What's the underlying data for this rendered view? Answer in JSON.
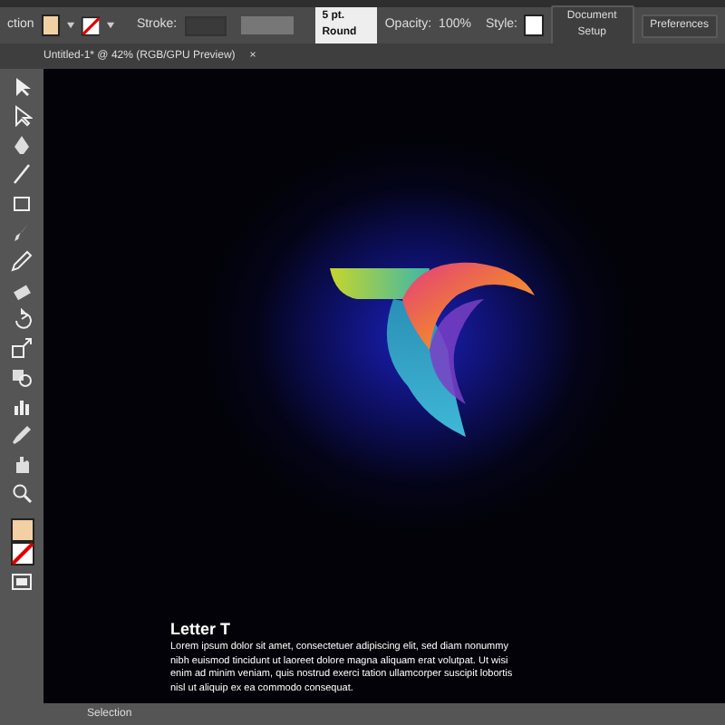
{
  "control_bar": {
    "cut_label": "ction",
    "stroke_label": "Stroke:",
    "brush": "5 pt. Round",
    "opacity_label": "Opacity:",
    "opacity": "100%",
    "style_label": "Style:",
    "buttons": [
      "Document Setup",
      "Preferences"
    ]
  },
  "document_tab": {
    "title": "Untitled-1* @ 42% (RGB/GPU Preview)",
    "close": "×"
  },
  "artboard": {
    "heading": "Letter T",
    "body": "Lorem ipsum dolor sit amet, consectetuer adipiscing elit, sed diam nonummy nibh euismod tincidunt ut laoreet dolore magna aliquam erat volutpat. Ut wisi enim ad minim veniam, quis nostrud exerci tation ullamcorper suscipit lobortis nisl ut aliquip ex ea commodo consequat."
  },
  "status_bar": {
    "tool": "Selection"
  }
}
